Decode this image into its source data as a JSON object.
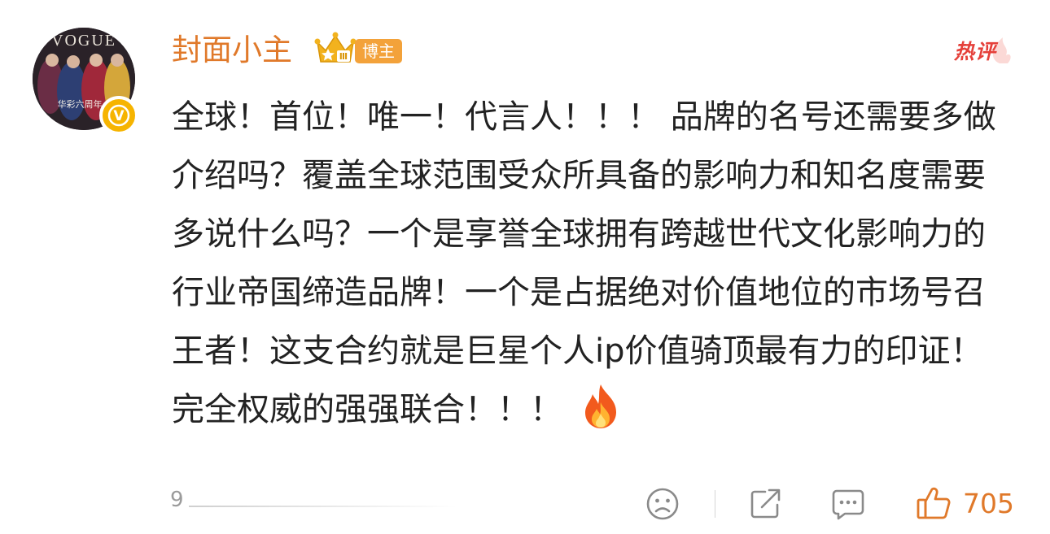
{
  "user": {
    "name": "封面小主",
    "badge": "博主",
    "crown_level": "Ⅲ",
    "avatar_text": "华彩六周年",
    "verified_letter": "V"
  },
  "hot_tag": "热评",
  "comment": {
    "text": "全球！首位！唯一！代言人！！！ 品牌的名号还需要多做介绍吗？覆盖全球范围受众所具备的影响力和知名度需要多说什么吗？一个是享誉全球拥有跨越世代文化影响力的行业帝国缔造品牌！一个是占据绝对价值地位的市场号召王者！这支合约就是巨星个人ip价值骑顶最有力的印证！完全权威的强强联合！！！",
    "emoji_icon": "fire-icon"
  },
  "footer": {
    "reply_count": "9",
    "like_count": "705",
    "icons": [
      "dislike-face-icon",
      "share-icon",
      "comment-icon",
      "thumbs-up-icon"
    ]
  },
  "colors": {
    "accent": "#e0792a",
    "hot_red": "#e5403a",
    "badge_orange": "#f3a23a",
    "verified_gold": "#f6b400",
    "text": "#222222",
    "muted": "#9b9b9b"
  }
}
